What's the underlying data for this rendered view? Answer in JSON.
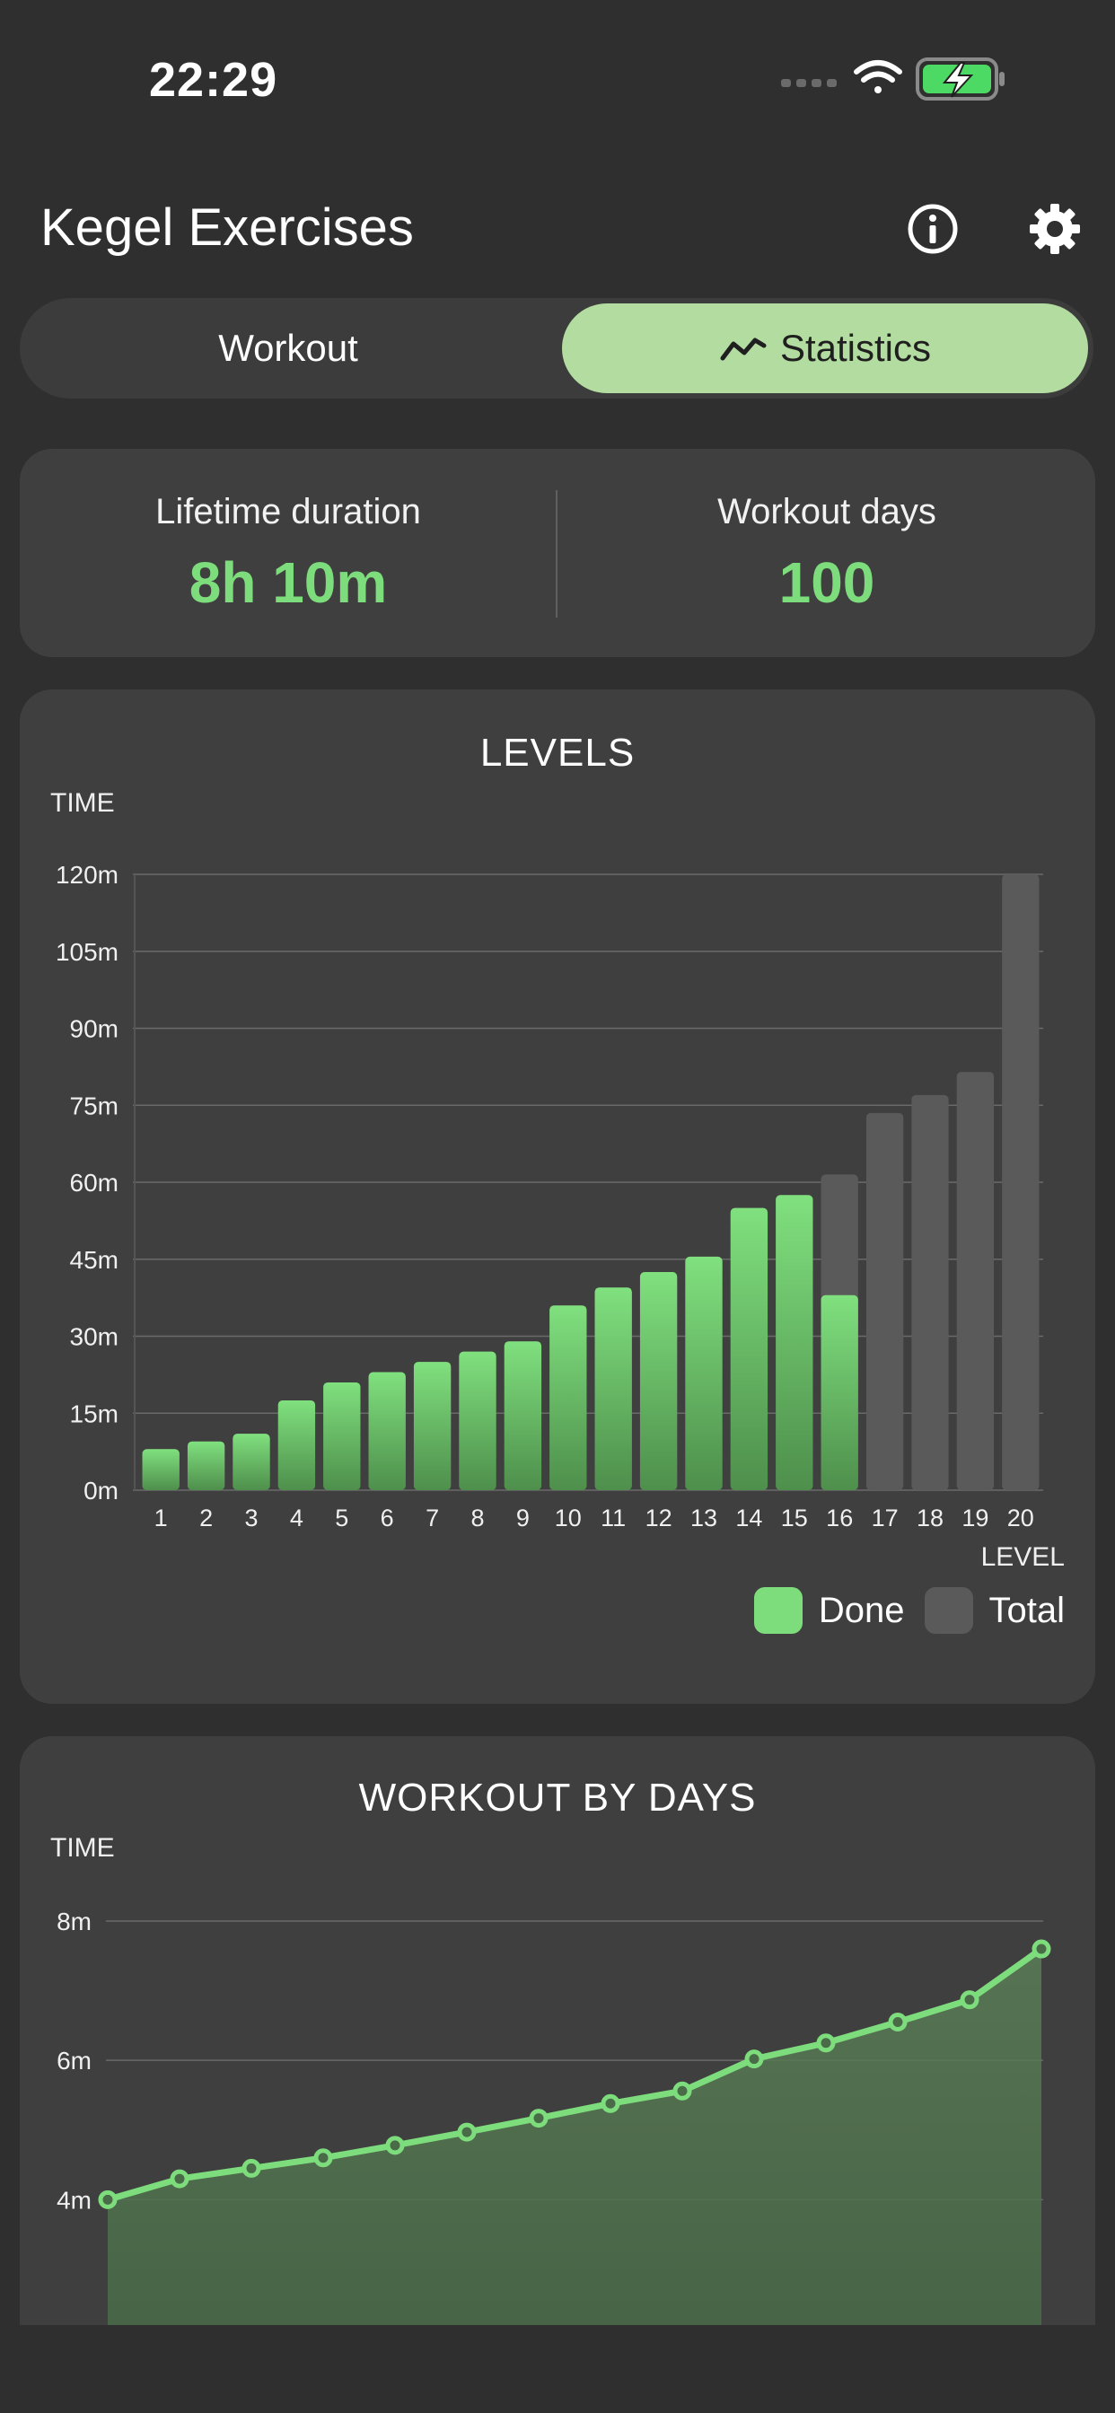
{
  "status": {
    "time": "22:29",
    "signal_icon": "cellular-dots-icon",
    "wifi_icon": "wifi-icon",
    "battery_icon": "battery-charging-icon",
    "battery_color": "#4cd964"
  },
  "header": {
    "title": "Kegel Exercises",
    "info_icon": "info-icon",
    "settings_icon": "gear-icon"
  },
  "tabs": [
    {
      "label": "Workout",
      "selected": false
    },
    {
      "label": "Statistics",
      "selected": true,
      "icon": "trend-line-icon"
    }
  ],
  "summary": {
    "lifetime_label": "Lifetime duration",
    "lifetime_value": "8h 10m",
    "days_label": "Workout days",
    "days_value": "100"
  },
  "colors": {
    "accent": "#7ddd7c",
    "tab_selected": "#b3dca0",
    "total_bar": "#5a5a5a",
    "card_bg": "#3f3f3f"
  },
  "chart_data": [
    {
      "type": "bar",
      "title": "LEVELS",
      "ylabel": "TIME",
      "xlabel": "LEVEL",
      "ylim": [
        0,
        120
      ],
      "y_ticks": [
        "0m",
        "15m",
        "30m",
        "45m",
        "60m",
        "75m",
        "90m",
        "105m",
        "120m"
      ],
      "y_tick_values": [
        0,
        15,
        30,
        45,
        60,
        75,
        90,
        105,
        120
      ],
      "categories": [
        "1",
        "2",
        "3",
        "4",
        "5",
        "6",
        "7",
        "8",
        "9",
        "10",
        "11",
        "12",
        "13",
        "14",
        "15",
        "16",
        "17",
        "18",
        "19",
        "20"
      ],
      "series": [
        {
          "name": "Total",
          "color": "#5a5a5a",
          "values": [
            8,
            9.5,
            11,
            17.5,
            21,
            23,
            25,
            27,
            29,
            36,
            39.5,
            42.5,
            45.5,
            55,
            57.5,
            61.5,
            73.5,
            77,
            81.5,
            120
          ]
        },
        {
          "name": "Done",
          "color": "#7ddd7c",
          "values": [
            8,
            9.5,
            11,
            17.5,
            21,
            23,
            25,
            27,
            29,
            36,
            39.5,
            42.5,
            45.5,
            55,
            57.5,
            38,
            0,
            0,
            0,
            0
          ]
        }
      ],
      "legend": "bottom-right",
      "grid": true
    },
    {
      "type": "area",
      "title": "WORKOUT BY DAYS",
      "ylabel": "TIME",
      "y_ticks": [
        "4m",
        "6m",
        "8m"
      ],
      "y_tick_values": [
        4,
        6,
        8
      ],
      "ylim": [
        2.2,
        8
      ],
      "series": [
        {
          "color": "#7ddd7c",
          "values": [
            4.0,
            4.3,
            4.45,
            4.6,
            4.78,
            4.97,
            5.17,
            5.38,
            5.56,
            6.02,
            6.25,
            6.55,
            6.87,
            7.6
          ]
        }
      ],
      "grid": true
    }
  ]
}
